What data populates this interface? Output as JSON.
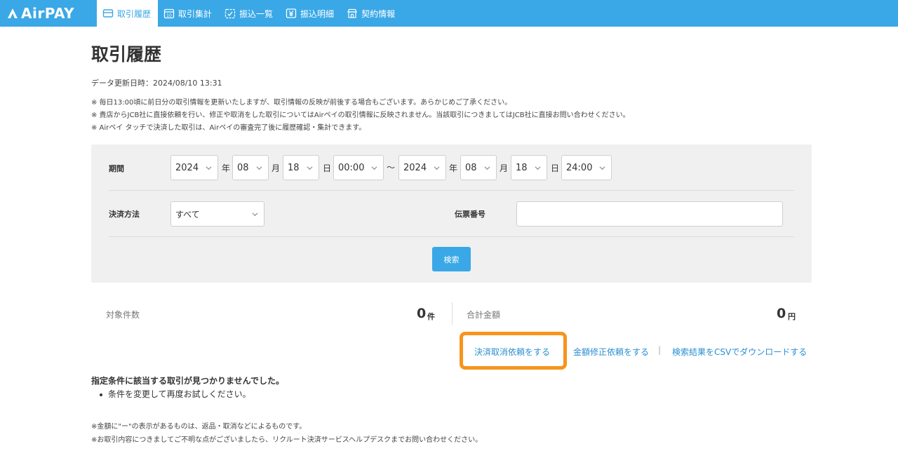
{
  "header": {
    "logo": "AirPAY",
    "nav": [
      {
        "label": "取引履歴",
        "icon": "card-icon",
        "active": true
      },
      {
        "label": "取引集計",
        "icon": "calendar-icon",
        "active": false
      },
      {
        "label": "振込一覧",
        "icon": "checklist-calendar-icon",
        "active": false
      },
      {
        "label": "振込明細",
        "icon": "yen-icon",
        "active": false
      },
      {
        "label": "契約情報",
        "icon": "shop-icon",
        "active": false
      }
    ]
  },
  "page": {
    "title": "取引履歴",
    "updated": "データ更新日時：2024/08/10 13:31",
    "notes": [
      "※  毎日13:00頃に前日分の取引情報を更新いたしますが、取引情報の反映が前後する場合もございます。あらかじめご了承ください。",
      "※  貴店からJCB社に直接依頼を行い、修正や取消をした取引についてはAirペイの取引情報に反映されません。当該取引につきましてはJCB社に直接お問い合わせください。",
      "※  Airペイ タッチで決済した取引は、Airペイの審査完了後に履歴確認・集計できます。"
    ]
  },
  "search": {
    "period_label": "期間",
    "from": {
      "year": "2024",
      "month": "08",
      "day": "18",
      "time": "00:00"
    },
    "to": {
      "year": "2024",
      "month": "08",
      "day": "18",
      "time": "24:00"
    },
    "unit_year": "年",
    "unit_month": "月",
    "unit_day": "日",
    "range_sep": "〜",
    "payment_label": "決済方法",
    "payment_value": "すべて",
    "slip_label": "伝票番号",
    "slip_value": "",
    "search_button": "検索"
  },
  "summary": {
    "count_label": "対象件数",
    "count_value": "0",
    "count_unit": "件",
    "total_label": "合計金額",
    "total_value": "0",
    "total_unit": "円"
  },
  "actions": {
    "cancel_request": "決済取消依頼をする",
    "amend_request": "金額修正依頼をする",
    "separator": "|",
    "csv_download": "検索結果をCSVでダウンロードする"
  },
  "results": {
    "no_results": "指定条件に該当する取引が見つかりませんでした。",
    "hint": "条件を変更して再度お試しください。"
  },
  "footer": {
    "notes": [
      "※金額に\"ー\"の表示があるものは、返品・取消などによるものです。",
      "※お取引内容につきましてご不明な点がございましたら、リクルート決済サービスヘルプデスクまでお問い合わせください。"
    ]
  },
  "colors": {
    "brand": "#3aa8e6",
    "highlight": "#f7941d",
    "link": "#2a8fd2"
  }
}
